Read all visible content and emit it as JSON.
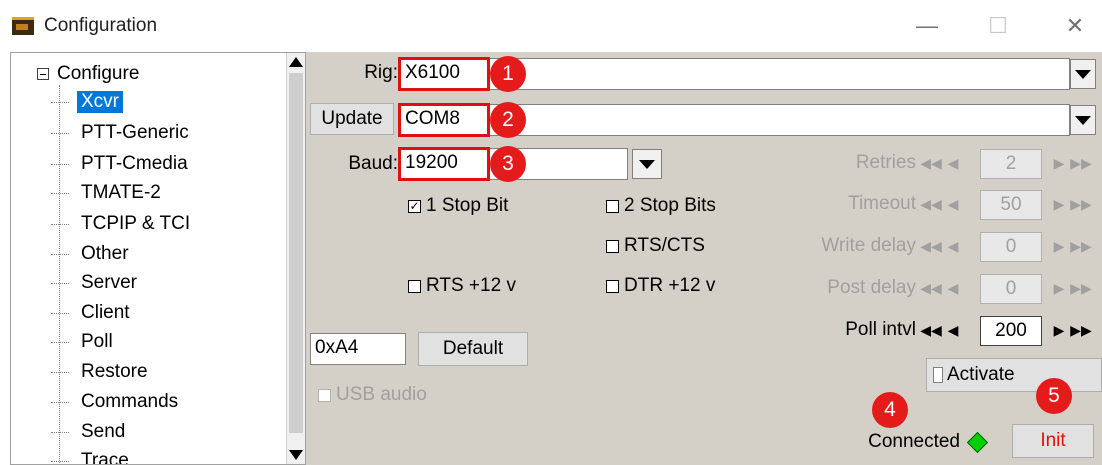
{
  "window": {
    "title": "Configuration",
    "minimize": "—",
    "maximize": "☐",
    "close": "✕"
  },
  "tree": {
    "root": "Configure",
    "items": [
      "Xcvr",
      "PTT-Generic",
      "PTT-Cmedia",
      "TMATE-2",
      "TCPIP & TCI",
      "Other",
      "Server",
      "Client",
      "Poll",
      "Restore",
      "Commands",
      "Send",
      "Trace"
    ],
    "selected": "Xcvr"
  },
  "form": {
    "rig_label": "Rig:",
    "rig_value": "X6100",
    "update_button": "Update",
    "port_value": "COM8",
    "baud_label": "Baud:",
    "baud_value": "19200",
    "stop1_label": "1 Stop Bit",
    "stop1_checked": true,
    "stop2_label": "2 Stop Bits",
    "rtscts_label": "RTS/CTS",
    "rts12_label": "RTS +12 v",
    "dtr12_label": "DTR +12 v",
    "civ_value": "0xA4",
    "default_button": "Default",
    "usb_audio_label": "USB audio",
    "activate_label": "Activate",
    "connected_label": "Connected",
    "init_button": "Init",
    "status_color": "#00d000"
  },
  "spinners": [
    {
      "label": "Retries",
      "value": "2"
    },
    {
      "label": "Timeout",
      "value": "50"
    },
    {
      "label": "Write delay",
      "value": "0"
    },
    {
      "label": "Post delay",
      "value": "0"
    },
    {
      "label": "Poll intvl",
      "value": "200"
    }
  ],
  "badges": [
    "1",
    "2",
    "3",
    "4",
    "5"
  ]
}
